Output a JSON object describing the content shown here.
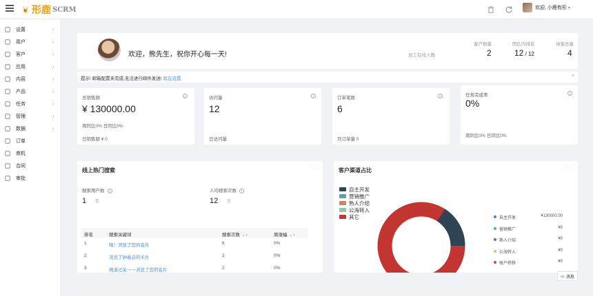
{
  "header": {
    "brand": "形鹿",
    "brand_sub": "SCRM",
    "user_greeting": "欢迎, 小鹿有形",
    "caret": "▾"
  },
  "sidebar": {
    "items": [
      {
        "label": "设置",
        "icon": "settings-icon",
        "has_arrow": true
      },
      {
        "label": "用户",
        "icon": "user-icon",
        "has_arrow": true
      },
      {
        "label": "客户",
        "icon": "monitor-icon",
        "has_arrow": true
      },
      {
        "label": "应用",
        "icon": "app-icon",
        "has_arrow": true
      },
      {
        "label": "内容",
        "icon": "content-icon",
        "has_arrow": true
      },
      {
        "label": "产品",
        "icon": "product-icon",
        "has_arrow": true
      },
      {
        "label": "任务",
        "icon": "task-icon",
        "has_arrow": true
      },
      {
        "label": "管理",
        "icon": "manage-icon",
        "has_arrow": true
      },
      {
        "label": "数据",
        "icon": "data-icon",
        "has_arrow": true
      },
      {
        "label": "订单",
        "icon": "order-icon",
        "has_arrow": false
      },
      {
        "label": "商机",
        "icon": "opportunity-icon",
        "has_arrow": false
      },
      {
        "label": "合同",
        "icon": "contract-icon",
        "has_arrow": false
      },
      {
        "label": "审批",
        "icon": "approval-icon",
        "has_arrow": false
      }
    ],
    "arrow": "›"
  },
  "welcome": {
    "message": "欢迎，熊先生，祝你开心每一天!",
    "employee_rank_label": "员工在线人数",
    "stats": [
      {
        "label": "客户数量",
        "value": "2",
        "suffix": ""
      },
      {
        "label": "团队内排名",
        "value": "12",
        "suffix": " / 12"
      },
      {
        "label": "待客总量",
        "value": "4",
        "suffix": ""
      }
    ]
  },
  "notice": {
    "text": "提示! 邮箱配置未完成,无法进行邮件发送! ",
    "link": "现在设置",
    "close": "×"
  },
  "kpis": [
    {
      "title": "总销售额",
      "value": "¥ 130000.00",
      "sub1": "周同比0%    日同比0%",
      "sub2": "日销售额  ¥ 0"
    },
    {
      "title": "访问量",
      "value": "12",
      "sub1": "",
      "sub2": "日访问量"
    },
    {
      "title": "订单笔数",
      "value": "6",
      "sub1": "",
      "sub2": "月订单量  0"
    },
    {
      "title": "任务完成率",
      "value": "0%",
      "sub1": "",
      "sub2": "周同比0%    日同比0%"
    }
  ],
  "hot_search": {
    "title": "线上热门搜索",
    "dots": "···",
    "metric1_label": "搜索用户数",
    "metric1_value": "1",
    "metric1_change": "0",
    "metric2_label": "人均搜索次数",
    "metric2_value": "12",
    "metric2_change": "0",
    "columns": [
      "排名",
      "搜索关键词",
      "搜索次数",
      "周涨幅"
    ],
    "rows": [
      {
        "rank": "1",
        "keyword": "嗨！浏览了您的名片",
        "count": "6",
        "change": "0%"
      },
      {
        "rank": "2",
        "keyword": "浏览了钟春云的卡片",
        "count": "2",
        "change": "0%"
      },
      {
        "rank": "3",
        "keyword": "阁道过关～～浏览了您的名片",
        "count": "2",
        "change": "0%"
      }
    ]
  },
  "channel": {
    "title": "客户渠道占比",
    "dots": "···",
    "legend_left": [
      {
        "name": "自主开发",
        "color": "#2f4554"
      },
      {
        "name": "营销推广",
        "color": "#61a0a8"
      },
      {
        "name": "熟人介绍",
        "color": "#d48265"
      },
      {
        "name": "公海转入",
        "color": "#91c7ae"
      },
      {
        "name": "其它",
        "color": "#c23531"
      }
    ],
    "legend_right": [
      {
        "name": "自主开发",
        "value": "¥130000.00",
        "color": "#3f7fd1"
      },
      {
        "name": "营销推广",
        "value": "¥0",
        "color": "#53b39b"
      },
      {
        "name": "熟人介绍",
        "value": "¥0",
        "color": "#6d6d8c"
      },
      {
        "name": "公海转入",
        "value": "¥0",
        "color": "#e6c33c"
      },
      {
        "name": "账户转移",
        "value": "¥0",
        "color": "#c74a6a"
      }
    ]
  },
  "chat_button": "消息"
}
